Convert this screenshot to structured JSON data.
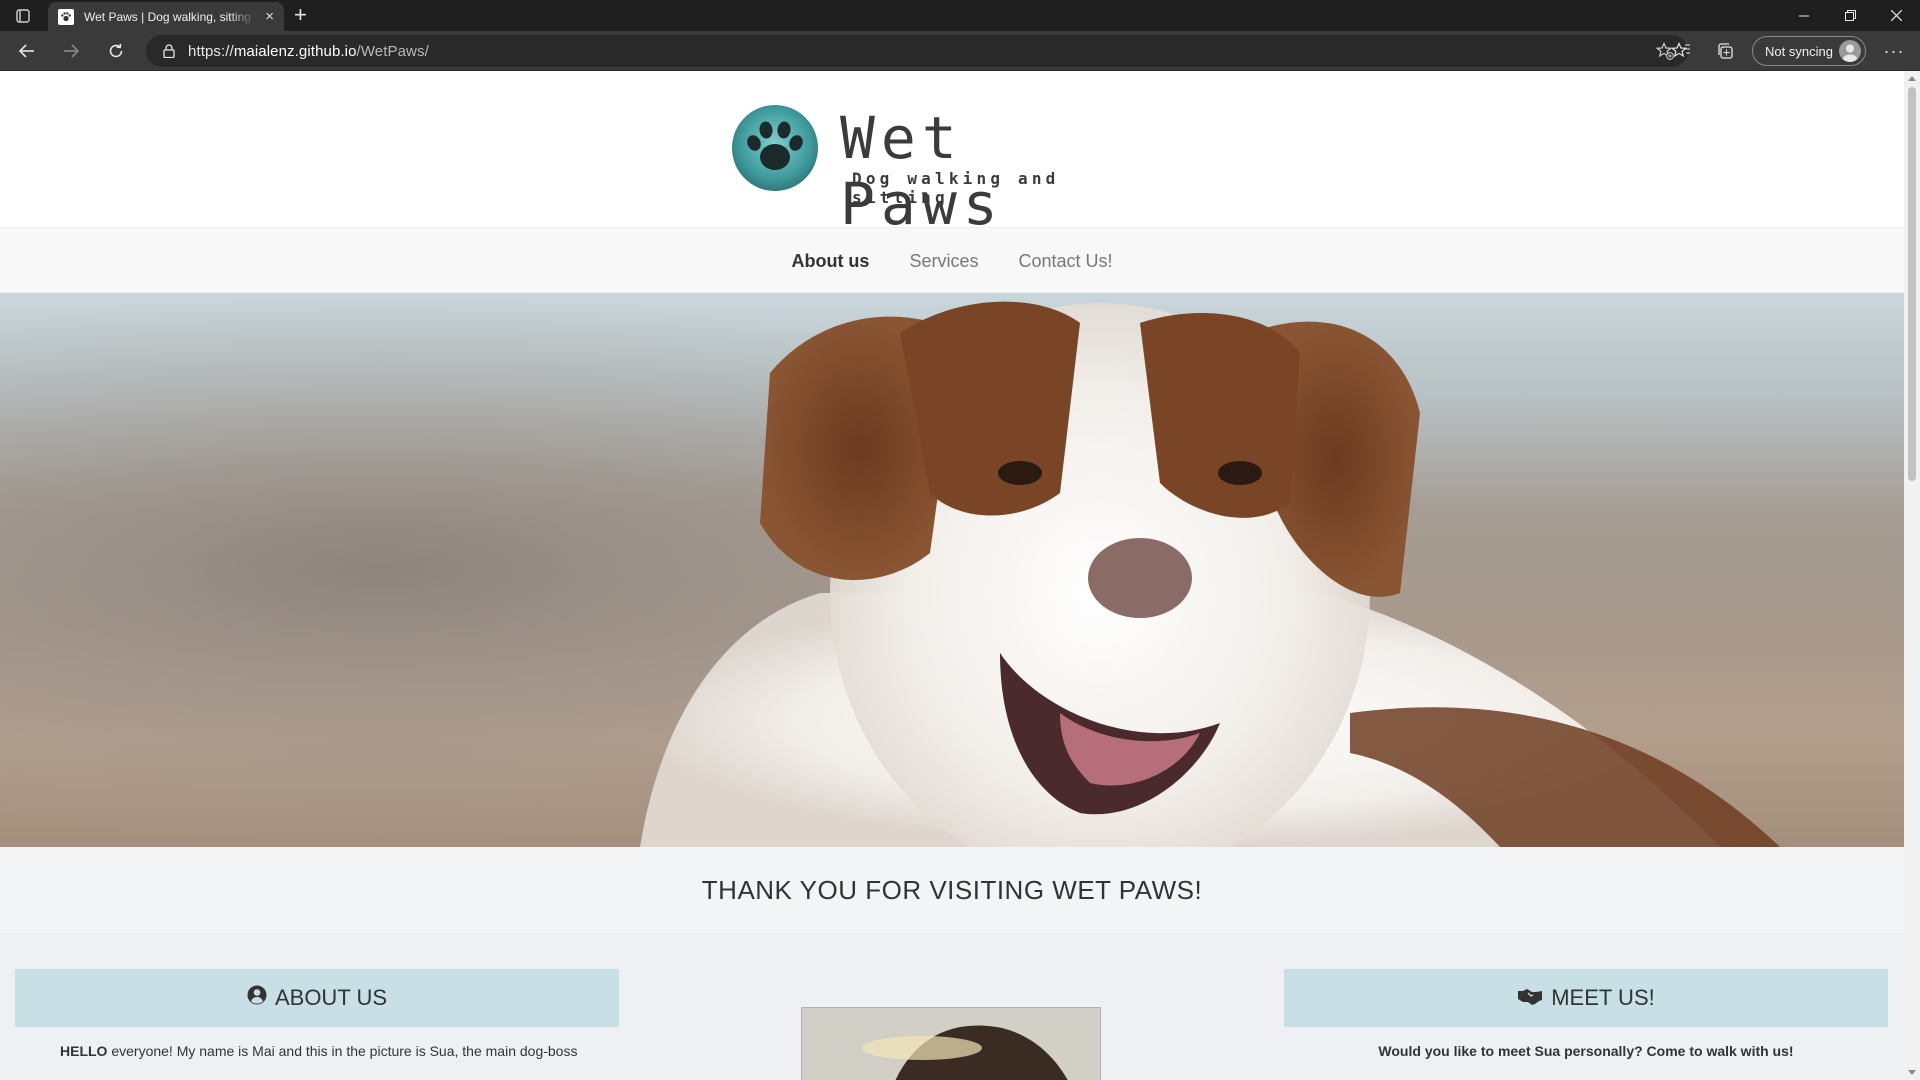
{
  "browser": {
    "tab_title": "Wet Paws | Dog walking, sitting and more",
    "url_scheme": "https://",
    "url_host": "maialenz.github.io",
    "url_path": "/WetPaws/",
    "sync_label": "Not syncing",
    "new_tab": "+",
    "close_tab": "×",
    "more": "···"
  },
  "site": {
    "logo_title": "Wet Paws",
    "logo_subtitle": "Dog walking and sitting",
    "nav": [
      {
        "label": "About us",
        "active": true
      },
      {
        "label": "Services",
        "active": false
      },
      {
        "label": "Contact Us!",
        "active": false
      }
    ],
    "thanks_heading": "THANK YOU FOR VISITING WET PAWS!",
    "about": {
      "heading": "ABOUT US",
      "text_bold": "HELLO",
      "text": " everyone! My name is Mai and this in the picture is Sua, the main dog-boss"
    },
    "meet": {
      "heading": "MEET US!",
      "text": "Would you like to meet Sua personally? Come to walk with us!"
    }
  },
  "colors": {
    "header_box_bg": "#c7dfe5",
    "nav_bg": "#f8f8f8",
    "thanks_bg": "#f3f4f6"
  }
}
